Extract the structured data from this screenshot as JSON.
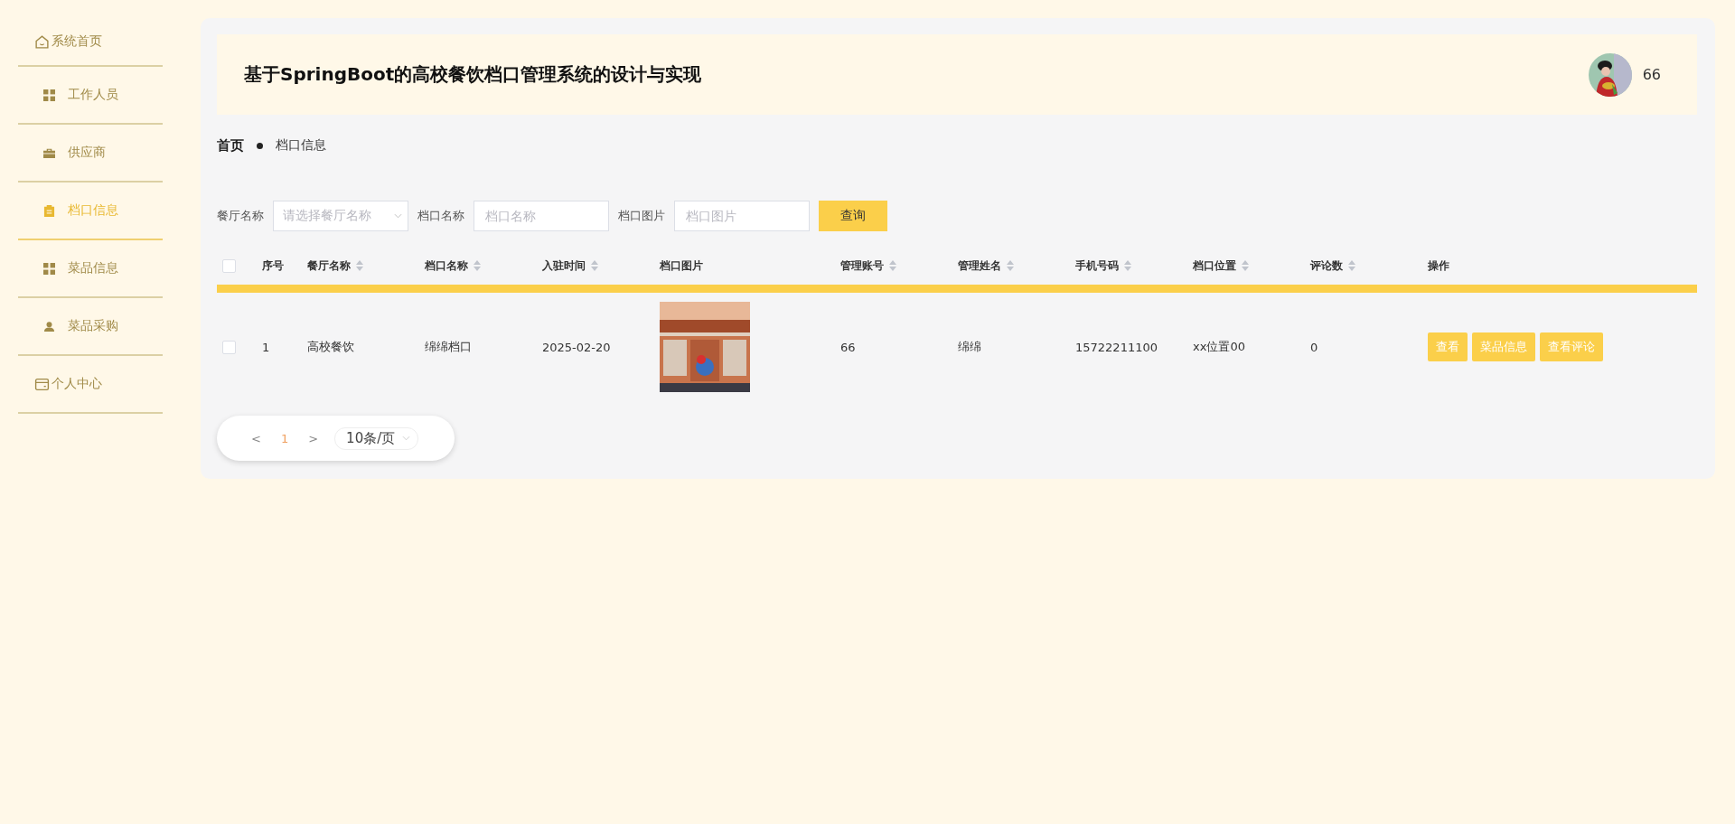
{
  "sidebar": {
    "items": [
      {
        "label": "系统首页",
        "selected": false
      },
      {
        "label": "工作人员",
        "selected": false
      },
      {
        "label": "供应商",
        "selected": false
      },
      {
        "label": "档口信息",
        "selected": true
      },
      {
        "label": "菜品信息",
        "selected": false
      },
      {
        "label": "菜品采购",
        "selected": false
      },
      {
        "label": "个人中心",
        "selected": false
      }
    ]
  },
  "header": {
    "title": "基于SpringBoot的高校餐饮档口管理系统的设计与实现",
    "username": "66"
  },
  "breadcrumb": [
    "首页",
    "档口信息"
  ],
  "search": {
    "fields": [
      {
        "label": "餐厅名称",
        "placeholder": "请选择餐厅名称",
        "kind": "select"
      },
      {
        "label": "档口名称",
        "placeholder": "档口名称",
        "kind": "input"
      },
      {
        "label": "档口图片",
        "placeholder": "档口图片",
        "kind": "input"
      }
    ],
    "button": "查询"
  },
  "table": {
    "header_checked": false,
    "columns": [
      {
        "label": "序号",
        "sortable": false
      },
      {
        "label": "餐厅名称",
        "sortable": true
      },
      {
        "label": "档口名称",
        "sortable": true
      },
      {
        "label": "入驻时间",
        "sortable": true
      },
      {
        "label": "档口图片",
        "sortable": false
      },
      {
        "label": "管理账号",
        "sortable": true
      },
      {
        "label": "管理姓名",
        "sortable": true
      },
      {
        "label": "手机号码",
        "sortable": true
      },
      {
        "label": "档口位置",
        "sortable": true
      },
      {
        "label": "评论数",
        "sortable": true
      },
      {
        "label": "操作",
        "sortable": false
      }
    ],
    "rows": [
      {
        "checked": false,
        "cells": [
          "1",
          "高校餐饮",
          "绵绵档口",
          "2025-02-20",
          {
            "kind": "picture"
          },
          "66",
          "绵绵",
          "15722211100",
          "xx位置00",
          "0"
        ],
        "actions": [
          "查看",
          "菜品信息",
          "查看评论"
        ]
      }
    ]
  },
  "pagination": {
    "prev": "<",
    "pages": [
      {
        "label": "1",
        "selected": true
      }
    ],
    "next": ">",
    "page_size": "10条/页"
  }
}
